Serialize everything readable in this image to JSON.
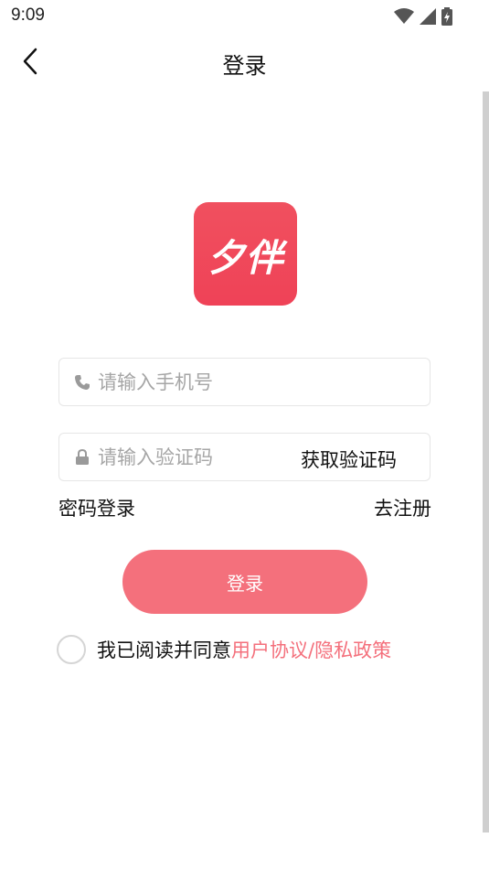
{
  "status_bar": {
    "time": "9:09",
    "icons": [
      "wifi-icon",
      "signal-icon",
      "battery-icon"
    ]
  },
  "nav": {
    "back_icon": "chevron-left-icon",
    "title": "登录"
  },
  "logo": {
    "text": "夕伴",
    "color": "#ef4759"
  },
  "phone_field": {
    "icon": "phone-icon",
    "placeholder": "请输入手机号",
    "value": ""
  },
  "code_field": {
    "icon": "lock-icon",
    "placeholder": "请输入验证码",
    "value": "",
    "get_code_label": "获取验证码"
  },
  "links": {
    "password_login": "密码登录",
    "register": "去注册"
  },
  "login_button": {
    "label": "登录",
    "color": "#f4707c"
  },
  "agreement": {
    "checked": false,
    "text": "我已阅读并同意",
    "link_text": "用户协议/隐私政策",
    "link_color": "#f4707c"
  }
}
